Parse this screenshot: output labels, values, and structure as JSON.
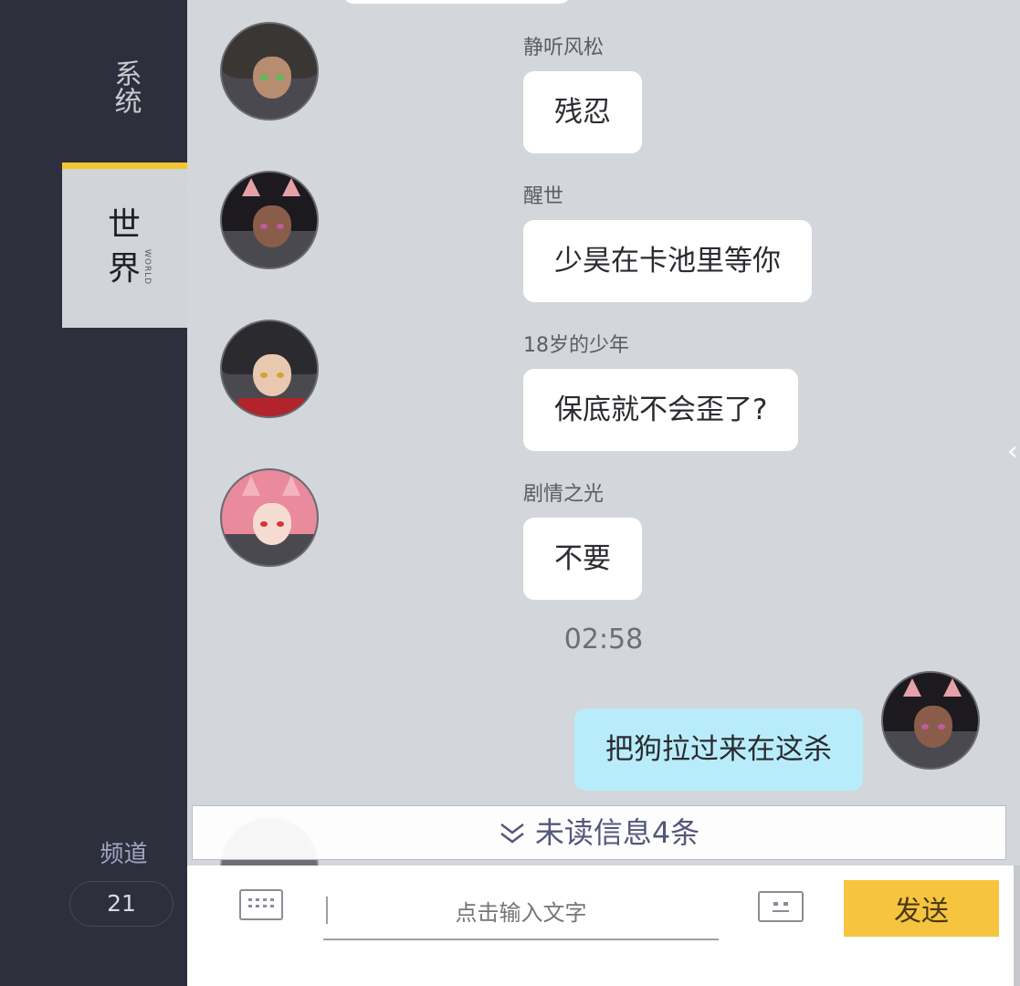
{
  "sidebar": {
    "tabs": [
      {
        "label": "系统",
        "sub": "",
        "active": false
      },
      {
        "label": "世界",
        "sub": "WORLD",
        "active": true
      }
    ],
    "channel_title": "频道",
    "channel_number": "21"
  },
  "messages": [
    {
      "user": "静听风松",
      "text": "残忍",
      "avatar_icon": "avatar-catgirl-icon"
    },
    {
      "user": "醒世",
      "text": "少昊在卡池里等你",
      "avatar_icon": "avatar-bunny-girl-icon"
    },
    {
      "user": "18岁的少年",
      "text": "保底就不会歪了?",
      "avatar_icon": "avatar-boy-icon"
    },
    {
      "user": "剧情之光",
      "text": "不要",
      "avatar_icon": "avatar-pink-bunny-icon"
    }
  ],
  "timestamp": "02:58",
  "my_message": {
    "text": "把狗拉过来在这杀",
    "avatar_icon": "avatar-self-icon"
  },
  "unread_bar": {
    "label": "未读信息4条"
  },
  "input_bar": {
    "placeholder": "点击输入文字",
    "send_label": "发送",
    "keyboard_icon": "keyboard-icon",
    "emoji_icon": "emoji-icon"
  },
  "colors": {
    "accent": "#f4c530",
    "send_button": "#f7c440",
    "my_bubble": "#b9ecfb",
    "sidebar_bg": "#2d2f3c",
    "chat_bg": "#d3d6da"
  }
}
